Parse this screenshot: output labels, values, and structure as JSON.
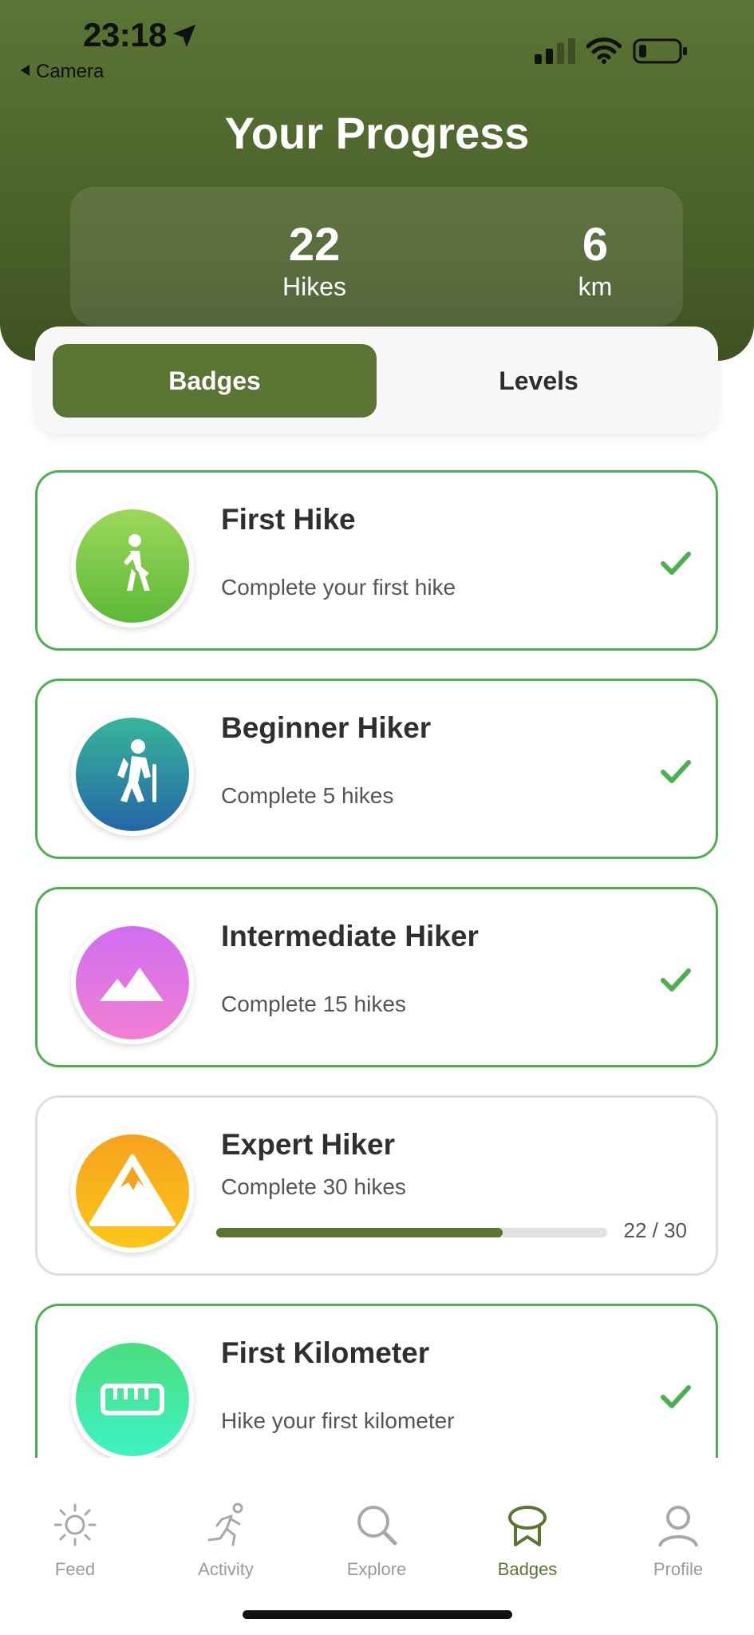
{
  "status_bar": {
    "time": "23:18",
    "back_label": "Camera"
  },
  "header": {
    "title": "Your Progress",
    "stats": [
      {
        "value": "22",
        "label": "Hikes"
      },
      {
        "value": "6",
        "label": "km"
      }
    ]
  },
  "segmented": {
    "active": "Badges",
    "inactive": "Levels"
  },
  "badges": [
    {
      "title": "First Hike",
      "description": "Complete your first hike",
      "completed": true,
      "icon": "hiker-walk-icon",
      "colors": [
        "#9cd85a",
        "#5db838"
      ]
    },
    {
      "title": "Beginner Hiker",
      "description": "Complete 5 hikes",
      "completed": true,
      "icon": "hiker-poles-icon",
      "colors": [
        "#38b59a",
        "#2466a6"
      ]
    },
    {
      "title": "Intermediate Hiker",
      "description": "Complete 15 hikes",
      "completed": true,
      "icon": "mountain-icon",
      "colors": [
        "#cf6ef1",
        "#f27fd2"
      ]
    },
    {
      "title": "Expert Hiker",
      "description": "Complete 30 hikes",
      "completed": false,
      "icon": "mountain-peak-icon",
      "colors": [
        "#f6a21e",
        "#fcc61a"
      ],
      "progress_text": "22 / 30",
      "progress_fraction": 0.733
    },
    {
      "title": "First Kilometer",
      "description": "Hike your first kilometer",
      "completed": true,
      "icon": "ruler-icon",
      "colors": [
        "#4ade7c",
        "#3ef2c6"
      ]
    }
  ],
  "tabs": [
    {
      "label": "Feed",
      "icon": "sun-icon",
      "active": false
    },
    {
      "label": "Activity",
      "icon": "running-icon",
      "active": false
    },
    {
      "label": "Explore",
      "icon": "search-icon",
      "active": false
    },
    {
      "label": "Badges",
      "icon": "badge-icon",
      "active": true
    },
    {
      "label": "Profile",
      "icon": "profile-icon",
      "active": false
    }
  ],
  "colors": {
    "accent": "#5a7433",
    "complete_border": "#4caf50",
    "header": "#4f672d"
  }
}
